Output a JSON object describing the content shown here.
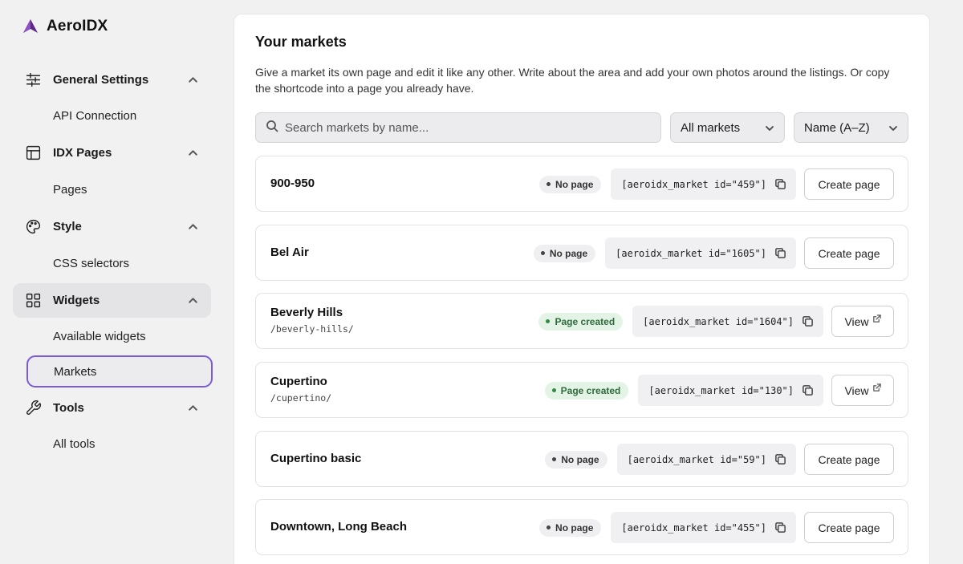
{
  "brand": {
    "name": "AeroIDX",
    "color": "#5b2a86"
  },
  "sidebar": {
    "groups": [
      {
        "label": "General Settings",
        "icon": "sliders-icon",
        "sub": [
          "API Connection"
        ]
      },
      {
        "label": "IDX Pages",
        "icon": "layout-icon",
        "sub": [
          "Pages"
        ]
      },
      {
        "label": "Style",
        "icon": "palette-icon",
        "sub": [
          "CSS selectors"
        ]
      },
      {
        "label": "Widgets",
        "icon": "grid-icon",
        "sub": [
          "Available widgets",
          "Markets"
        ],
        "active": true
      },
      {
        "label": "Tools",
        "icon": "wrench-icon",
        "sub": [
          "All tools"
        ]
      }
    ],
    "active_item": "Markets"
  },
  "main": {
    "title": "Your markets",
    "description": "Give a market its own page and edit it like any other. Write about the area and add your own photos around the listings. Or copy the shortcode into a page you already have.",
    "search_placeholder": "Search markets by name...",
    "filter_value": "All markets",
    "sort_value": "Name (A–Z)",
    "markets": [
      {
        "name": "900-950",
        "slug": "",
        "status": "No page",
        "shortcode": "[aeroidx_market id=\"459\"]",
        "action": "Create page"
      },
      {
        "name": "Bel Air",
        "slug": "",
        "status": "No page",
        "shortcode": "[aeroidx_market id=\"1605\"]",
        "action": "Create page"
      },
      {
        "name": "Beverly Hills",
        "slug": "/beverly-hills/",
        "status": "Page created",
        "shortcode": "[aeroidx_market id=\"1604\"]",
        "action": "View"
      },
      {
        "name": "Cupertino",
        "slug": "/cupertino/",
        "status": "Page created",
        "shortcode": "[aeroidx_market id=\"130\"]",
        "action": "View"
      },
      {
        "name": "Cupertino basic",
        "slug": "",
        "status": "No page",
        "shortcode": "[aeroidx_market id=\"59\"]",
        "action": "Create page"
      },
      {
        "name": "Downtown, Long Beach",
        "slug": "",
        "status": "No page",
        "shortcode": "[aeroidx_market id=\"455\"]",
        "action": "Create page"
      }
    ]
  },
  "colors": {
    "accent_outline": "#7b5cd6",
    "status_created_bg": "#e3f4e6",
    "status_created_text": "#2f6b3c",
    "status_none_bg": "#efeff1"
  }
}
